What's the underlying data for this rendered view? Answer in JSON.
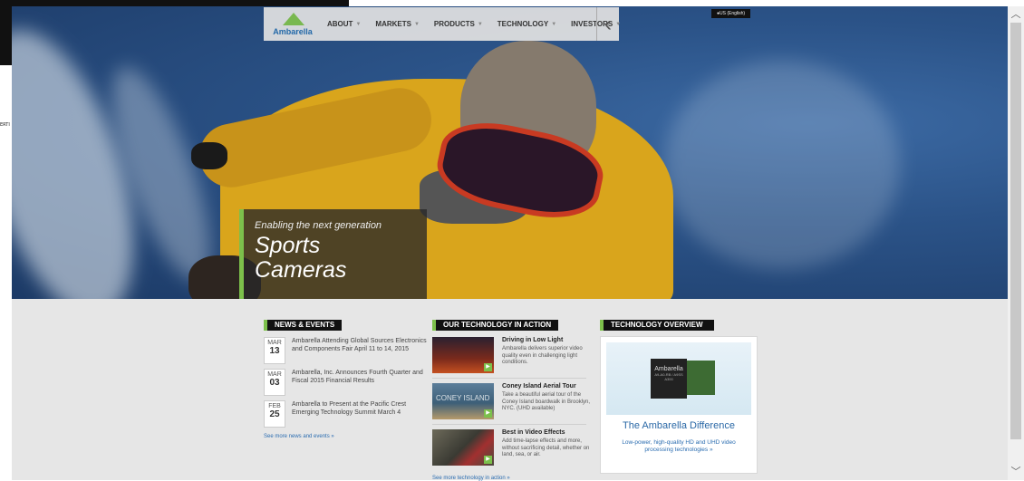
{
  "nav": {
    "logo_text": "Ambarella",
    "items": [
      {
        "label": "ABOUT"
      },
      {
        "label": "MARKETS"
      },
      {
        "label": "PRODUCTS"
      },
      {
        "label": "TECHNOLOGY"
      },
      {
        "label": "INVESTORS"
      }
    ],
    "back_icon": "chevron-left-icon",
    "region_label": "●US (English)"
  },
  "artifact_text": "ERTI",
  "hero": {
    "subtitle": "Enabling the next generation",
    "title_line1": "Sports",
    "title_line2": "Cameras"
  },
  "news": {
    "heading": "NEWS & EVENTS",
    "items": [
      {
        "month": "MAR",
        "day": "13",
        "text": "Ambarella Attending Global Sources Electronics and Components Fair April 11 to 14, 2015"
      },
      {
        "month": "MAR",
        "day": "03",
        "text": "Ambarella, Inc. Announces Fourth Quarter and Fiscal 2015 Financial Results"
      },
      {
        "month": "FEB",
        "day": "25",
        "text": "Ambarella to Present at the Pacific Crest Emerging Technology Summit March 4"
      }
    ],
    "see_more": "See more news and events »"
  },
  "tech_action": {
    "heading": "OUR TECHNOLOGY IN ACTION",
    "items": [
      {
        "title": "Driving in Low Light",
        "desc": "Ambarella delivers superior video quality even in challenging light conditions."
      },
      {
        "title": "Coney Island Aerial Tour",
        "desc": "Take a beautiful aerial tour of the Coney Island boardwalk in Brooklyn, NYC. (UHD available)",
        "thumb_text": "CONEY ISLAND"
      },
      {
        "title": "Best in Video Effects",
        "desc": "Add time-lapse effects and more, without sacrificing detail, whether on land, sea, or air."
      }
    ],
    "see_more": "See more technology in action »"
  },
  "overview": {
    "heading": "TECHNOLOGY OVERVIEW",
    "chip_logo": "Ambarella",
    "chip_marking": "A9-A0-RB / A9SS",
    "chip_model": "A300",
    "title": "The Ambarella Difference",
    "desc": "Low-power, high-quality HD and UHD video processing technologies »"
  },
  "colors": {
    "accent_green": "#7cc04b",
    "link_blue": "#2a6cb0",
    "heading_black": "#111111"
  }
}
